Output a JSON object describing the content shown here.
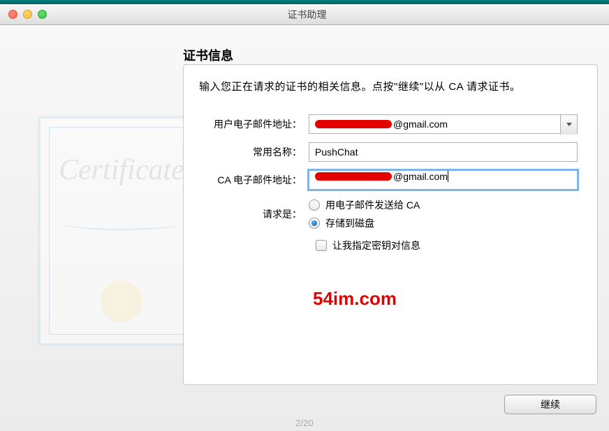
{
  "window": {
    "title": "证书助理"
  },
  "section": {
    "title": "证书信息",
    "instruction": "输入您正在请求的证书的相关信息。点按\"继续\"以从 CA 请求证书。"
  },
  "form": {
    "user_email_label": "用户电子邮件地址：",
    "user_email_value": "@gmail.com",
    "common_name_label": "常用名称：",
    "common_name_value": "PushChat",
    "ca_email_label": "CA 电子邮件地址：",
    "ca_email_value": "@gmail.com",
    "request_label": "请求是：",
    "radio_email": "用电子邮件发送给 CA",
    "radio_disk": "存储到磁盘",
    "checkbox_keypair": "让我指定密钥对信息"
  },
  "cert_graphic": {
    "script_text": "Certificate"
  },
  "watermark": "54im.com",
  "buttons": {
    "continue": "继续"
  },
  "pager": "2/20"
}
